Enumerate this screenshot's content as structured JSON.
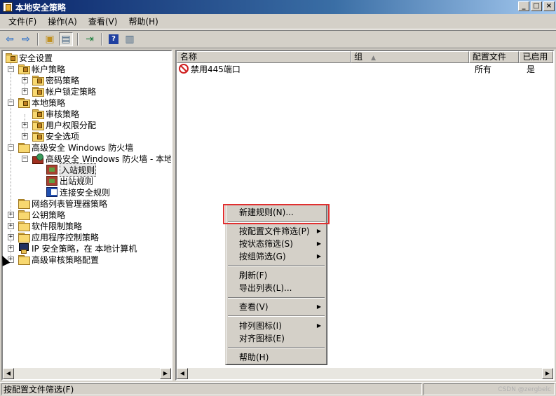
{
  "window": {
    "title": "本地安全策略",
    "minimize": "_",
    "maximize": "□",
    "close": "×"
  },
  "menu": [
    "文件(F)",
    "操作(A)",
    "查看(V)",
    "帮助(H)"
  ],
  "tree": {
    "root": "安全设置",
    "account_policies": "帐户策略",
    "password_policy": "密码策略",
    "lockout_policy": "帐户锁定策略",
    "local_policies": "本地策略",
    "audit_policy": "审核策略",
    "user_rights": "用户权限分配",
    "security_options": "安全选项",
    "firewall": "高级安全 Windows 防火墙",
    "firewall_local": "高级安全 Windows 防火墙 - 本地",
    "inbound_rules": "入站规则",
    "outbound_rules": "出站规则",
    "connection_rules": "连接安全规则",
    "network_list": "网络列表管理器策略",
    "public_key": "公钥策略",
    "software_restriction": "软件限制策略",
    "app_control": "应用程序控制策略",
    "ipsec": "IP 安全策略，在 本地计算机",
    "advanced_audit": "高级审核策略配置"
  },
  "list": {
    "columns": [
      "名称",
      "组",
      "配置文件",
      "已启用"
    ],
    "rows": [
      {
        "name": "禁用445端口",
        "group": "",
        "profile": "所有",
        "enabled": "是"
      }
    ]
  },
  "context_menu": {
    "new_rule": "新建规则(N)...",
    "filter_profile": "按配置文件筛选(P)",
    "filter_state": "按状态筛选(S)",
    "filter_group": "按组筛选(G)",
    "refresh": "刷新(F)",
    "export": "导出列表(L)...",
    "view": "查看(V)",
    "arrange": "排列图标(I)",
    "align": "对齐图标(E)",
    "help": "帮助(H)"
  },
  "status": {
    "text": "按配置文件筛选(F)",
    "watermark": "CSDN @zergbelc"
  }
}
